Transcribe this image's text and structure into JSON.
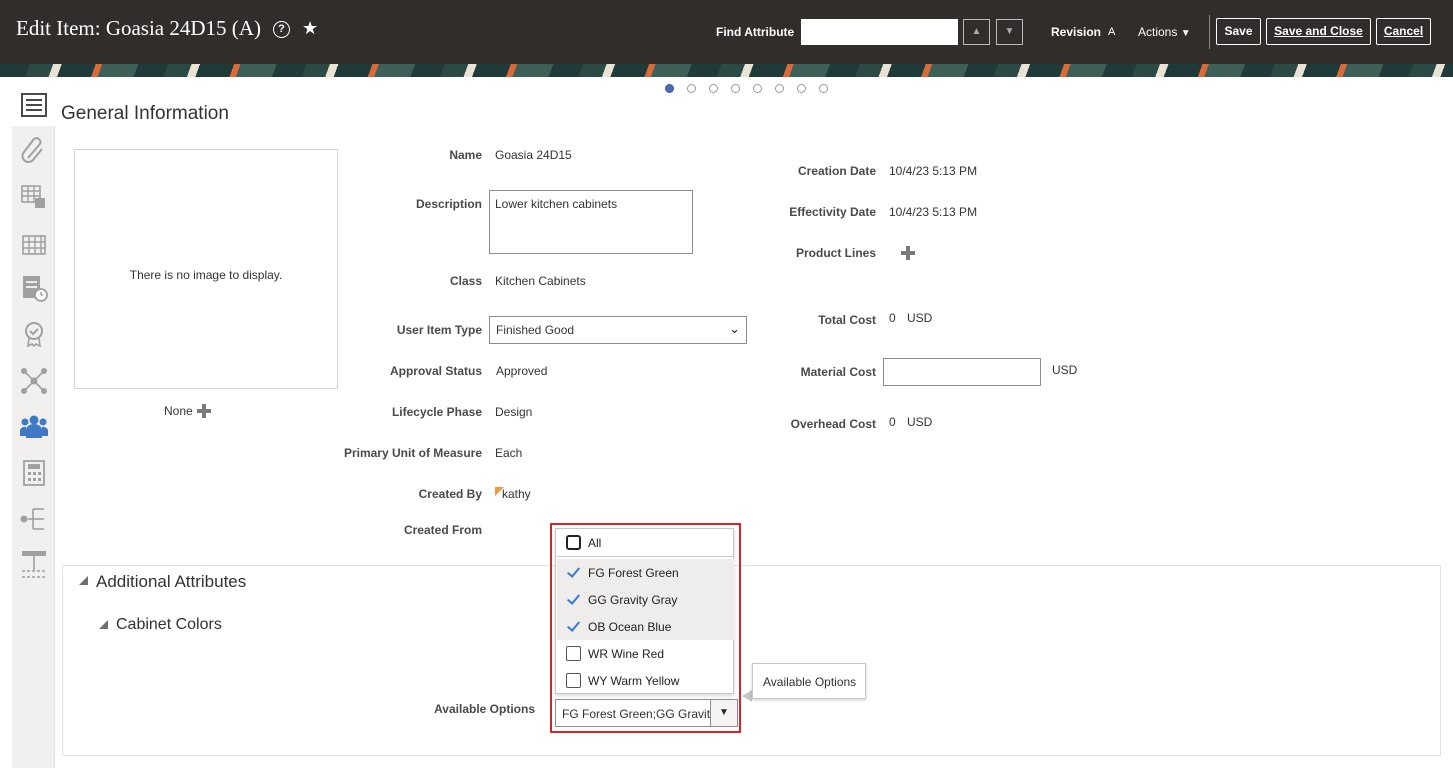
{
  "header": {
    "title": "Edit Item: Goasia 24D15 (A)",
    "find_attribute_label": "Find Attribute",
    "find_attribute_value": "",
    "revision_label": "Revision",
    "revision_value": "A",
    "actions_label": "Actions",
    "save_label": "Save",
    "save_close_label": "Save and Close",
    "cancel_label": "Cancel"
  },
  "left_nav": {
    "items": [
      "list-icon",
      "paperclip-icon",
      "grid-cube-icon",
      "building-icon",
      "document-clock-icon",
      "badge-icon",
      "network-icon",
      "people-icon",
      "calculator-icon",
      "hierarchy-icon",
      "structure-icon"
    ],
    "active_index": 0
  },
  "pager": {
    "count": 8,
    "active": 0
  },
  "section": {
    "title": "General Information"
  },
  "image": {
    "no_image_text": "There is no image to display.",
    "none_label": "None"
  },
  "fields": {
    "name_label": "Name",
    "name_value": "Goasia 24D15",
    "description_label": "Description",
    "description_value": "Lower kitchen cabinets",
    "class_label": "Class",
    "class_value": "Kitchen Cabinets",
    "user_item_type_label": "User Item Type",
    "user_item_type_value": "Finished Good",
    "approval_status_label": "Approval Status",
    "approval_status_value": "Approved",
    "lifecycle_phase_label": "Lifecycle Phase",
    "lifecycle_phase_value": "Design",
    "primary_uom_label": "Primary Unit of Measure",
    "primary_uom_value": "Each",
    "created_by_label": "Created By",
    "created_by_value": "kathy",
    "created_from_label": "Created From",
    "creation_date_label": "Creation Date",
    "creation_date_value": "10/4/23 5:13 PM",
    "effectivity_date_label": "Effectivity Date",
    "effectivity_date_value": "10/4/23 5:13 PM",
    "product_lines_label": "Product Lines",
    "total_cost_label": "Total Cost",
    "total_cost_value": "0",
    "total_cost_currency": "USD",
    "material_cost_label": "Material Cost",
    "material_cost_value": "",
    "material_cost_currency": "USD",
    "overhead_cost_label": "Overhead Cost",
    "overhead_cost_value": "0",
    "overhead_cost_currency": "USD"
  },
  "additional_attributes": {
    "title": "Additional Attributes",
    "group_title": "Cabinet Colors",
    "available_options_label": "Available Options",
    "available_options_value": "FG Forest Green;GG Gravity Gray;OB Ocean Blue",
    "options": [
      {
        "label": "All",
        "checked": false
      },
      {
        "label": "FG Forest Green",
        "checked": true
      },
      {
        "label": "GG Gravity Gray",
        "checked": true
      },
      {
        "label": "OB Ocean Blue",
        "checked": true
      },
      {
        "label": "WR Wine Red",
        "checked": false
      },
      {
        "label": "WY Warm Yellow",
        "checked": false
      }
    ],
    "tooltip": "Available Options"
  },
  "colors": {
    "header_bg": "#312d2a",
    "highlight": "#d8232a",
    "check": "#3a7bd5"
  }
}
